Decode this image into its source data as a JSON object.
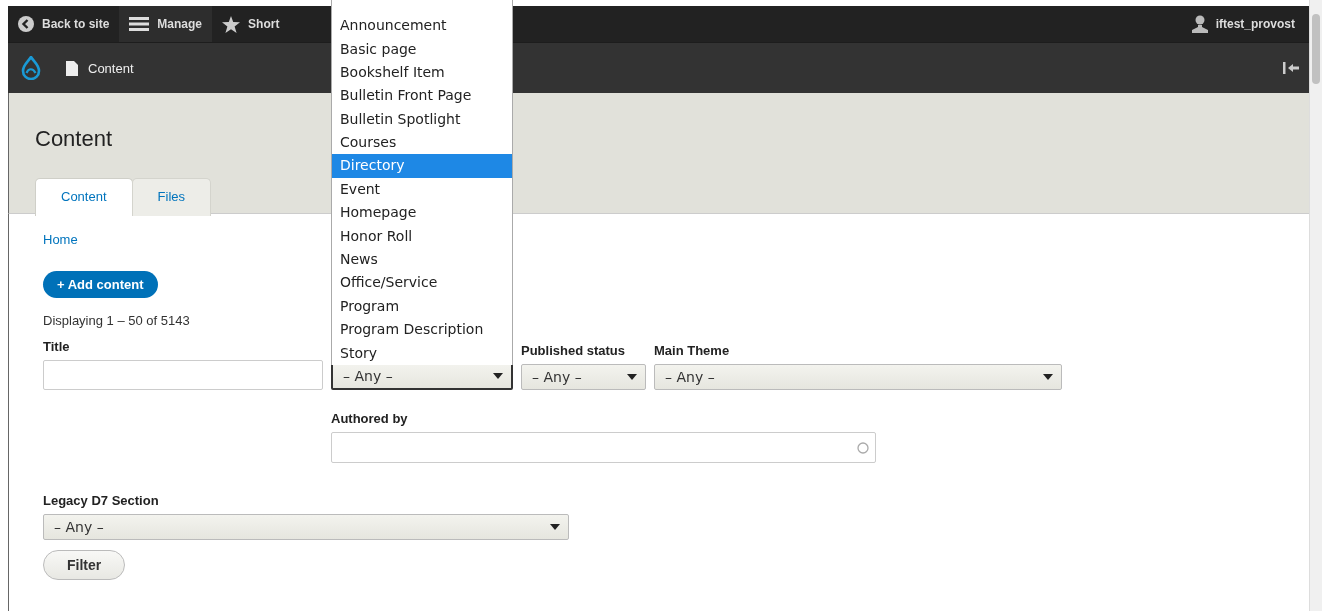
{
  "toolbar": {
    "items": [
      {
        "label": "Back to site",
        "kind": "back"
      },
      {
        "label": "Manage",
        "kind": "menu"
      },
      {
        "label": "Short",
        "kind": "star"
      }
    ],
    "user": "iftest_provost"
  },
  "tray": {
    "item": "Content"
  },
  "page_title": "Content",
  "tabs": [
    {
      "label": "Content",
      "selected": true
    },
    {
      "label": "Files",
      "selected": false
    }
  ],
  "breadcrumb": "Home",
  "add_button": "+ Add content",
  "summary": "Displaying 1 – 50 of 5143",
  "filter_rows": [
    {
      "fields": [
        {
          "kind": "text",
          "label": "Title"
        },
        {
          "kind": "select",
          "value": "– Any –",
          "open": true
        },
        {
          "kind": "select",
          "label": "Published status",
          "value": "– Any –",
          "open": false
        },
        {
          "kind": "select",
          "label": "Main Theme",
          "value": "– Any –",
          "open": false
        }
      ]
    },
    {
      "fields": [
        {
          "kind": "autocomplete",
          "label": "Authored by"
        }
      ]
    },
    {
      "fields": [
        {
          "kind": "select",
          "label": "Legacy D7 Section",
          "value": "– Any –",
          "open": false
        }
      ]
    }
  ],
  "dropdown_options": [
    {
      "label": "Announcement",
      "selected": false
    },
    {
      "label": "Basic page",
      "selected": false
    },
    {
      "label": "Bookshelf Item",
      "selected": false
    },
    {
      "label": "Bulletin Front Page",
      "selected": false
    },
    {
      "label": "Bulletin Spotlight",
      "selected": false
    },
    {
      "label": "Courses",
      "selected": false
    },
    {
      "label": "Directory",
      "selected": true
    },
    {
      "label": "Event",
      "selected": false
    },
    {
      "label": "Homepage",
      "selected": false
    },
    {
      "label": "Honor Roll",
      "selected": false
    },
    {
      "label": "News",
      "selected": false
    },
    {
      "label": "Office/Service",
      "selected": false
    },
    {
      "label": "Program",
      "selected": false
    },
    {
      "label": "Program Description",
      "selected": false
    },
    {
      "label": "Story",
      "selected": false
    }
  ],
  "filter_button": "Filter"
}
